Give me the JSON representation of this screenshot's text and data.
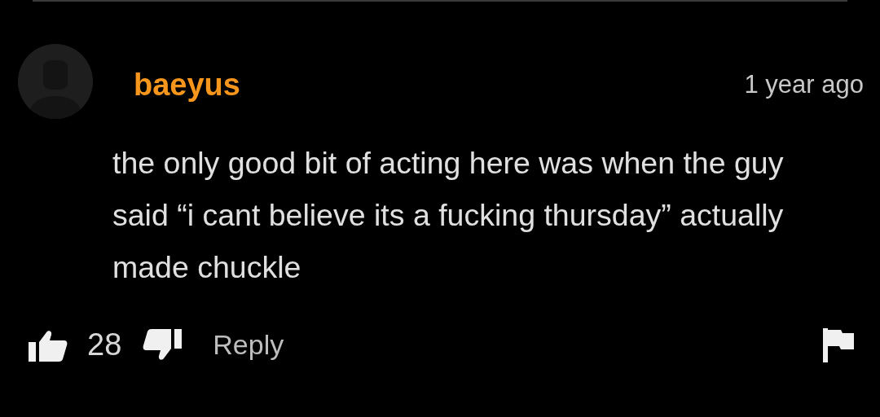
{
  "comment": {
    "author": "baeyus",
    "time": "1 year ago",
    "text": "the only good bit of acting here was when the guy said “i cant believe its a fucking thursday” actually made chuckle",
    "likes": "28",
    "reply": "Reply"
  }
}
